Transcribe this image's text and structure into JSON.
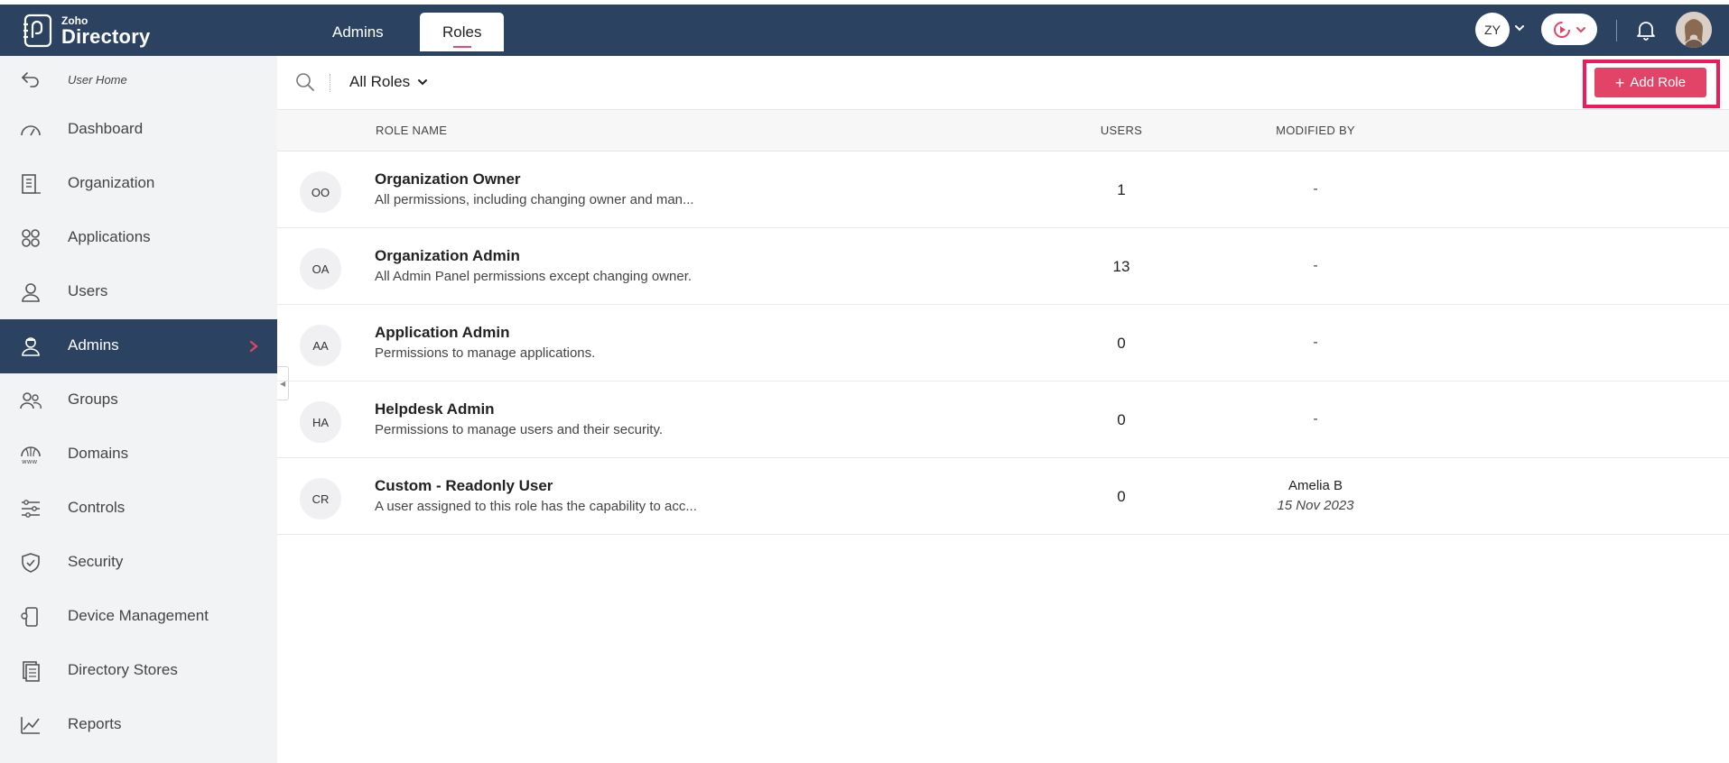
{
  "app": {
    "brand_small": "Zoho",
    "brand_name": "Directory"
  },
  "header": {
    "tabs": [
      {
        "label": "Admins",
        "active": false
      },
      {
        "label": "Roles",
        "active": true
      }
    ],
    "org_initials": "ZY",
    "icons": [
      "org-switcher-chevron-icon",
      "screen-record-icon",
      "bell-icon",
      "user-avatar"
    ],
    "accent_color": "#e24468",
    "bar_color": "#2b4361"
  },
  "sidebar": {
    "back_label": "User Home",
    "items": [
      {
        "label": "Dashboard",
        "icon": "dashboard-icon"
      },
      {
        "label": "Organization",
        "icon": "organization-icon"
      },
      {
        "label": "Applications",
        "icon": "applications-icon"
      },
      {
        "label": "Users",
        "icon": "user-icon"
      },
      {
        "label": "Admins",
        "icon": "admin-icon",
        "active": true
      },
      {
        "label": "Groups",
        "icon": "groups-icon"
      },
      {
        "label": "Domains",
        "icon": "domains-icon"
      },
      {
        "label": "Controls",
        "icon": "controls-icon"
      },
      {
        "label": "Security",
        "icon": "shield-icon"
      },
      {
        "label": "Device Management",
        "icon": "device-icon"
      },
      {
        "label": "Directory Stores",
        "icon": "stores-icon"
      },
      {
        "label": "Reports",
        "icon": "reports-icon"
      }
    ]
  },
  "toolbar": {
    "filter_label": "All Roles",
    "add_button_label": "Add Role"
  },
  "table": {
    "headers": {
      "name": "ROLE NAME",
      "users": "USERS",
      "modified_by": "MODIFIED BY"
    },
    "rows": [
      {
        "initials": "OO",
        "name": "Organization Owner",
        "description": "All permissions, including changing owner and man...",
        "users": "1",
        "modified_by": "-",
        "modified_date": ""
      },
      {
        "initials": "OA",
        "name": "Organization Admin",
        "description": "All Admin Panel permissions except changing owner.",
        "users": "13",
        "modified_by": "-",
        "modified_date": ""
      },
      {
        "initials": "AA",
        "name": "Application Admin",
        "description": "Permissions to manage applications.",
        "users": "0",
        "modified_by": "-",
        "modified_date": ""
      },
      {
        "initials": "HA",
        "name": "Helpdesk Admin",
        "description": "Permissions to manage users and their security.",
        "users": "0",
        "modified_by": "-",
        "modified_date": ""
      },
      {
        "initials": "CR",
        "name": "Custom - Readonly User",
        "description": "A user assigned to this role has the capability to acc...",
        "users": "0",
        "modified_by": "Amelia B",
        "modified_date": "15 Nov 2023"
      }
    ]
  }
}
